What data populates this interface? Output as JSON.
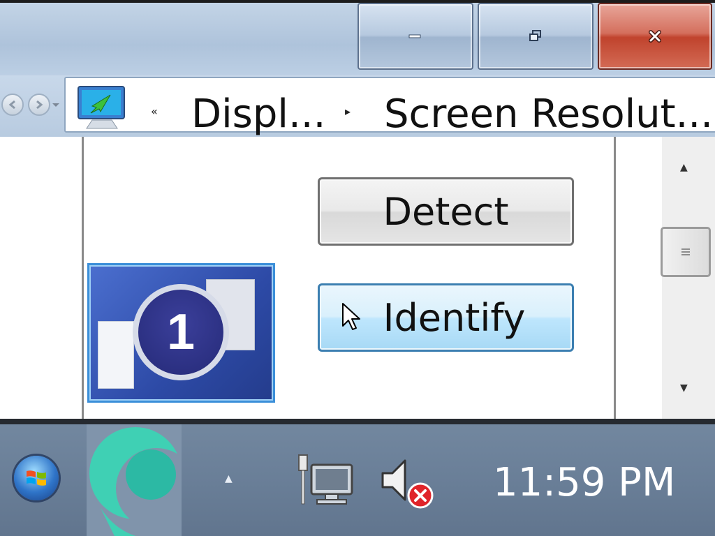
{
  "window": {
    "minimize_icon": "minimize-icon",
    "maximize_icon": "restore-icon",
    "close_icon": "close-icon",
    "close_color": "#c0432d"
  },
  "address_bar": {
    "back_icon": "back-arrow-icon",
    "forward_icon": "forward-arrow-icon",
    "location_icon": "display-settings-icon",
    "breadcrumbs": [
      "Displ...",
      "Screen Resolut..."
    ]
  },
  "content": {
    "detect_label": "Detect",
    "identify_label": "Identify",
    "monitor_number": "1"
  },
  "scrollbar": {
    "up_arrow": "▲",
    "down_arrow": "▼"
  },
  "taskbar": {
    "start_icon": "windows-start-icon",
    "app_icon": "app-icon",
    "tray_show_hidden": "▲",
    "network_icon": "network-icon",
    "volume_icon": "volume-muted-icon",
    "clock": "11:59 PM"
  }
}
